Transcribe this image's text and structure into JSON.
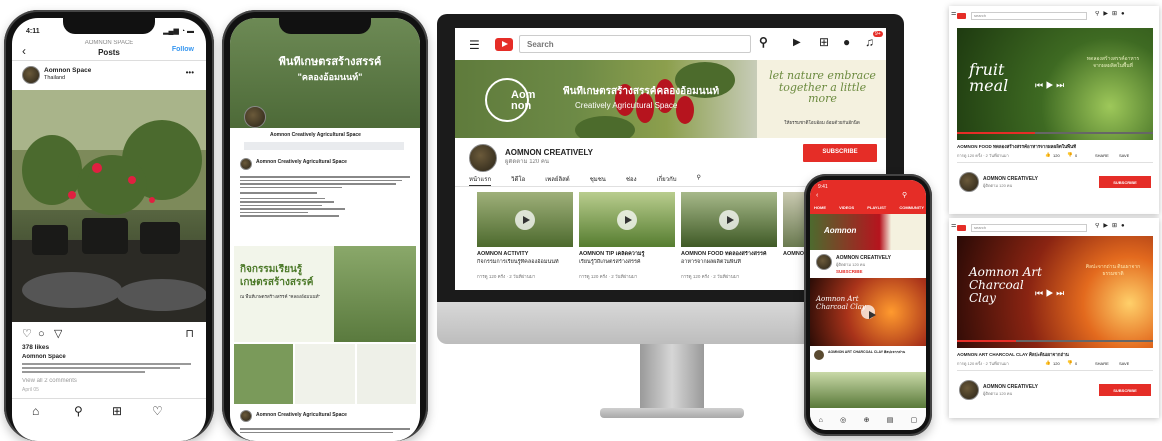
{
  "instagram": {
    "time": "4:11",
    "header_sub": "AOMNON SPACE",
    "header_title": "Posts",
    "follow": "Follow",
    "username": "Aomnon Space",
    "location": "Thailand",
    "likes": "378 likes",
    "caption_user": "Aomnon Space",
    "view_comments": "View all 2 comments",
    "date": "April 05"
  },
  "facebook": {
    "cover_title": "พื้นที่เกษตรสร้างสรรค์",
    "cover_sub": "\"คลองอ้อมนนท์\"",
    "page_name": "Aomnon Creatively Agricultural Space",
    "post_author": "Aomnon Creatively Agricultural Space",
    "poster_title": "กิจกรรมเรียนรู้ เกษตรสร้างสรรค์",
    "poster_sub": "ณ พื้นที่เกษตรสร้างสรรค์ \"คลองอ้อมนนท์\"",
    "footer_author": "Aomnon Creatively Agricultural Space"
  },
  "youtube_desktop": {
    "search_placeholder": "Search",
    "notif_count": "9+",
    "banner_logo": "Aom non",
    "banner_title": "พื้นที่เกษตรสร้างสรรค์คลองอ้อมนนท์",
    "banner_sub": "Creatively Agricultural Space",
    "tagline": "let nature embrace together a little more",
    "tagline_thai": "ให้ธรรมชาติโอบอ้อม อ้อมด้วยกันอีกนิด",
    "channel_name": "AOMNON CREATIVELY",
    "subscribers": "ผู้ติดตาม 120 คน",
    "subscribe": "SUBSCRIBE",
    "tabs": [
      "หน้าแรก",
      "วิดีโอ",
      "เพลย์ลิสต์",
      "ชุมชน",
      "ช่อง",
      "เกี่ยวกับ"
    ],
    "videos": [
      {
        "title": "AOMNON ACTIVITY",
        "desc": "กิจกรรมการเรียนรู้ที่คลองอ้อมนนท์",
        "meta": "การดู 120 ครั้ง · 2 วันที่ผ่านมา"
      },
      {
        "title": "AOMNON TIP เคล็ดความรู้",
        "desc": "เรียนรู้วิถีเกษตรสร้างสรรค์",
        "meta": "การดู 120 ครั้ง · 2 วันที่ผ่านมา"
      },
      {
        "title": "AOMNON FOOD ทดลองสร้างสรรค์",
        "desc": "อาหารจากผลผลิตในพื้นที่",
        "meta": "การดู 120 ครั้ง · 2 วันที่ผ่านมา"
      },
      {
        "title": "AOMNON",
        "desc": "",
        "meta": ""
      }
    ]
  },
  "youtube_mobile": {
    "time": "9:41",
    "tabs": [
      "HOME",
      "VIDEOS",
      "PLAYLIST",
      "COMMUNITY"
    ],
    "banner_logo": "Aomnon",
    "channel_name": "AOMNON CREATIVELY",
    "subscribers": "ผู้ติดตาม 120 คน",
    "subscribe": "SUBSCRIBE",
    "video_title": "Aomnon Art Charcoal Clay",
    "list_title": "AOMNON ART CHARCOAL CLAY ศิลปะจากถ่าน",
    "nav": [
      "Home",
      "Explore",
      "",
      "Subscriptions",
      "Library"
    ]
  },
  "video_page_1": {
    "search_placeholder": "search",
    "overlay": "fruit meal",
    "overlay_thai": "ทดลองสร้างสรรค์อาหารจากผลผลิตในพื้นที่",
    "title": "AOMNON FOOD ทดลองสร้างสรรค์อาหารจากผลผลิตในพื้นที่",
    "meta": "การดู 120 ครั้ง · 2 วันที่ผ่านมา",
    "likes": "120",
    "dislikes": "0",
    "share": "SHARE",
    "save": "SAVE",
    "channel_name": "AOMNON CREATIVELY",
    "subscribers": "ผู้ติดตาม 120 คน",
    "subscribe": "SUBSCRIBE"
  },
  "video_page_2": {
    "search_placeholder": "search",
    "overlay": "Aomnon Art Charcoal Clay",
    "overlay_thai": "ศิลปะจากถ่าน ดินเผาจากธรรมชาติ",
    "title": "AOMNON ART CHARCOAL CLAY ศิลปะดินเผาจากถ่าน",
    "meta": "การดู 120 ครั้ง · 2 วันที่ผ่านมา",
    "likes": "120",
    "dislikes": "0",
    "share": "SHARE",
    "save": "SAVE",
    "channel_name": "AOMNON CREATIVELY",
    "subscribers": "ผู้ติดตาม 120 คน",
    "subscribe": "SUBSCRIBE"
  },
  "colors": {
    "youtube_red": "#e52d27",
    "instagram_blue": "#3897f0",
    "banner_green": "#f4f1df"
  }
}
